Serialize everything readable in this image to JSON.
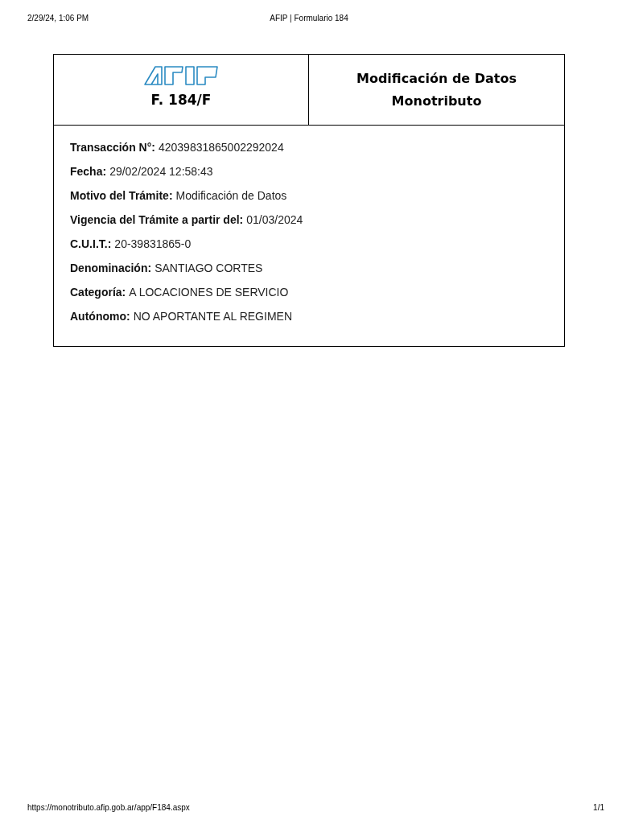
{
  "print_header": {
    "date": "2/29/24, 1:06 PM",
    "title": "AFIP | Formulario 184"
  },
  "form": {
    "code": "F. 184/F",
    "title_lines": [
      "Modificación de Datos",
      "Monotributo"
    ],
    "fields": [
      {
        "label": "Transacción N°:",
        "value": "42039831865002292024"
      },
      {
        "label": "Fecha:",
        "value": "29/02/2024 12:58:43"
      },
      {
        "label": "Motivo del Trámite:",
        "value": "Modificación de Datos"
      },
      {
        "label": "Vigencia del Trámite a partir del:",
        "value": "01/03/2024"
      },
      {
        "label": "C.U.I.T.:",
        "value": "20-39831865-0"
      },
      {
        "label": "Denominación:",
        "value": "SANTIAGO CORTES"
      },
      {
        "label": "Categoría:",
        "value": "A LOCACIONES DE SERVICIO"
      },
      {
        "label": "Autónomo:",
        "value": "NO APORTANTE AL REGIMEN"
      }
    ]
  },
  "print_footer": {
    "url": "https://monotributo.afip.gob.ar/app/F184.aspx",
    "page": "1/1"
  }
}
